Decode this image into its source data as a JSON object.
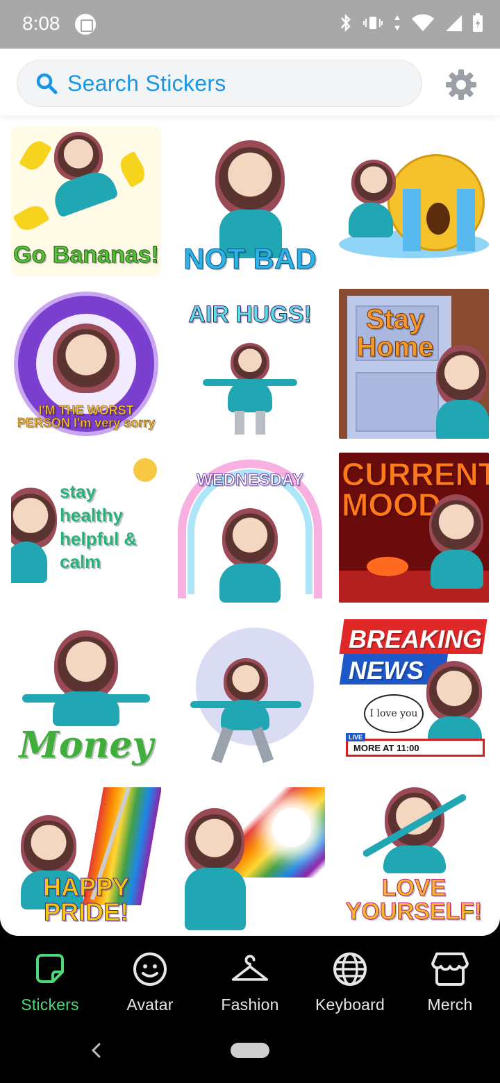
{
  "status": {
    "time": "8:08"
  },
  "search": {
    "placeholder": "Search Stickers"
  },
  "stickers": [
    {
      "caption": "Go Bananas!"
    },
    {
      "caption": "NOT BAD"
    },
    {
      "caption": ""
    },
    {
      "caption": "I'M THE WORST PERSON I'm very sorry"
    },
    {
      "caption": "AIR HUGS!"
    },
    {
      "caption": "Stay Home"
    },
    {
      "caption": "stay healthy helpful & calm"
    },
    {
      "caption": "WEDNESDAY"
    },
    {
      "caption": "CURRENT MOOD"
    },
    {
      "caption": "Money"
    },
    {
      "caption": ""
    },
    {
      "caption": "BREAKING NEWS"
    },
    {
      "caption": "HAPPY PRIDE!"
    },
    {
      "caption": ""
    },
    {
      "caption": "LOVE YOURSELF!"
    }
  ],
  "breaking": {
    "bubble": "I love you",
    "live": "LIVE",
    "ticker": "MORE AT 11:00"
  },
  "nav": {
    "items": [
      {
        "label": "Stickers",
        "icon": "sticker-icon"
      },
      {
        "label": "Avatar",
        "icon": "smiley-icon"
      },
      {
        "label": "Fashion",
        "icon": "hanger-icon"
      },
      {
        "label": "Keyboard",
        "icon": "globe-icon"
      },
      {
        "label": "Merch",
        "icon": "shop-icon"
      }
    ]
  },
  "colors": {
    "accent": "#1996e6",
    "nav_active": "#4cd97b",
    "status_bar": "#a8a8a8"
  }
}
